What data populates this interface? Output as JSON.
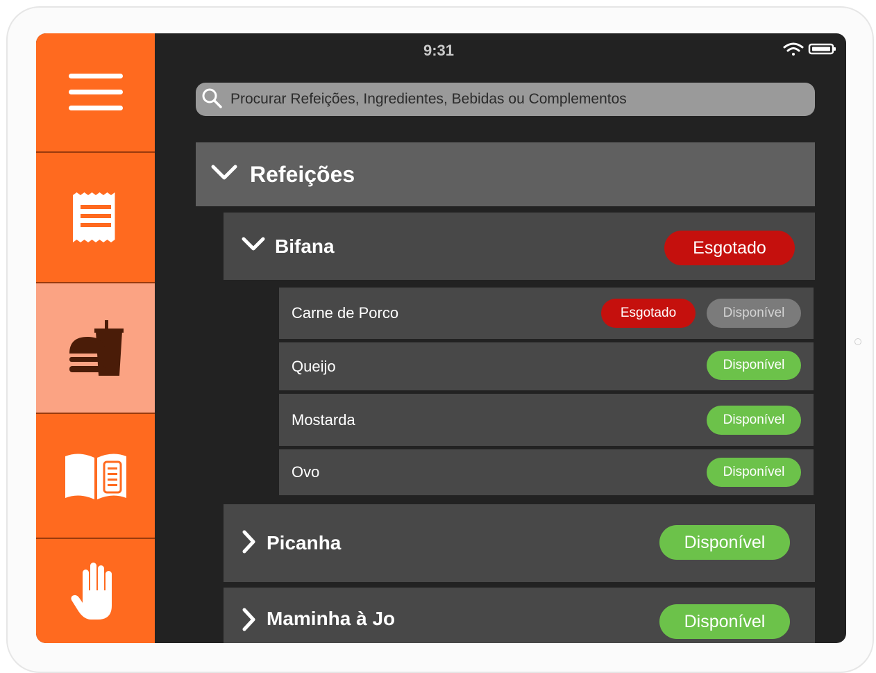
{
  "status_bar": {
    "time": "9:31",
    "icons": [
      "wifi-icon",
      "battery-icon"
    ]
  },
  "sidebar": {
    "items": [
      {
        "name": "menu",
        "icon": "hamburger-menu-icon"
      },
      {
        "name": "orders",
        "icon": "receipt-icon"
      },
      {
        "name": "food",
        "icon": "burger-drink-icon",
        "active": true
      },
      {
        "name": "menu-book",
        "icon": "open-book-icon"
      },
      {
        "name": "help",
        "icon": "raised-hand-icon"
      }
    ]
  },
  "search": {
    "placeholder": "Procurar Refeições, Ingredientes, Bebidas ou Complementos",
    "value": ""
  },
  "category": {
    "title": "Refeições",
    "expanded": true,
    "meals": [
      {
        "name": "Bifana",
        "status": "Esgotado",
        "expanded": true,
        "ingredients": [
          {
            "name": "Carne de Porco",
            "status": "Esgotado",
            "alt_status": "Disponível"
          },
          {
            "name": "Queijo",
            "status": "Disponível"
          },
          {
            "name": "Mostarda",
            "status": "Disponível"
          },
          {
            "name": "Ovo",
            "status": "Disponível"
          }
        ]
      },
      {
        "name": "Picanha",
        "status": "Disponível",
        "expanded": false
      },
      {
        "name": "Maminha à Jo",
        "status": "Disponível",
        "expanded": false
      }
    ]
  },
  "colors": {
    "accent": "#ff6a1f",
    "active_tab": "#fba383",
    "sold_out": "#c5100d",
    "available": "#6cc24a",
    "inactive": "#7b7b7b"
  }
}
